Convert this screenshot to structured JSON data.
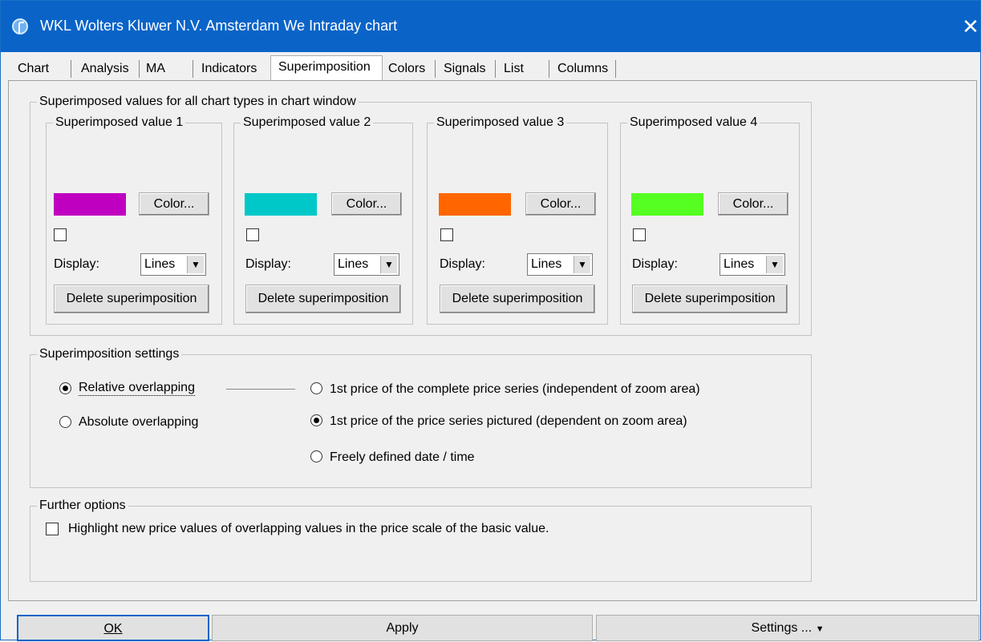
{
  "window": {
    "title": "WKL Wolters Kluwer N.V. Amsterdam We Intraday chart"
  },
  "tabs": [
    {
      "label": "Chart"
    },
    {
      "label": "Analysis"
    },
    {
      "label": "MA"
    },
    {
      "label": "Indicators"
    },
    {
      "label": "Superimposition",
      "active": true
    },
    {
      "label": "Colors"
    },
    {
      "label": "Signals"
    },
    {
      "label": "List"
    },
    {
      "label": "Columns"
    }
  ],
  "superimposed": {
    "title": "Superimposed values for all chart types in chart window",
    "values": [
      {
        "title": "Superimposed value 1",
        "color": "#c000c0",
        "color_button": "Color...",
        "display_label": "Display:",
        "display_value": "Lines",
        "delete_button": "Delete superimposition"
      },
      {
        "title": "Superimposed value 2",
        "color": "#00c8c8",
        "color_button": "Color...",
        "display_label": "Display:",
        "display_value": "Lines",
        "delete_button": "Delete superimposition"
      },
      {
        "title": "Superimposed value 3",
        "color": "#ff6600",
        "color_button": "Color...",
        "display_label": "Display:",
        "display_value": "Lines",
        "delete_button": "Delete superimposition"
      },
      {
        "title": "Superimposed value 4",
        "color": "#55ff22",
        "color_button": "Color...",
        "display_label": "Display:",
        "display_value": "Lines",
        "delete_button": "Delete superimposition"
      }
    ]
  },
  "settings": {
    "title": "Superimposition settings",
    "relative_label": "Relative overlapping",
    "absolute_label": "Absolute overlapping",
    "option_complete": "1st price of the complete price series (independent of zoom area)",
    "option_pictured": "1st price of the price series pictured (dependent on zoom area)",
    "option_free": "Freely defined date / time"
  },
  "further": {
    "title": "Further options",
    "highlight_label": "Highlight new price values of overlapping values in the price scale of the basic value."
  },
  "buttons": {
    "ok": "OK",
    "apply": "Apply",
    "settings": "Settings ..."
  }
}
